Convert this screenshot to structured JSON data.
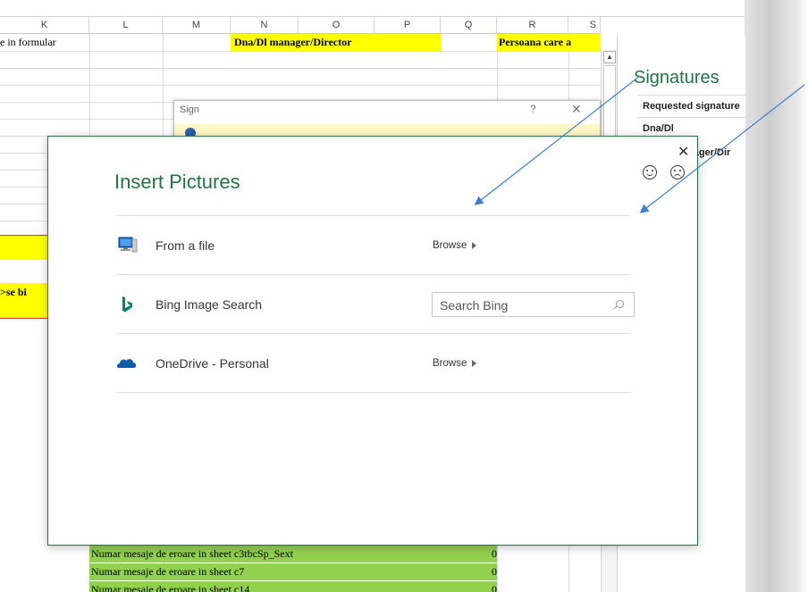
{
  "spreadsheet": {
    "columns": [
      "K",
      "L",
      "M",
      "N",
      "O",
      "P",
      "Q",
      "R",
      "S"
    ],
    "cells": {
      "k_row1": "e in formular",
      "n_row1": "Dna/Dl manager/Director",
      "r_row1": "Persoana care a",
      "k_red": ">se bi"
    },
    "green_rows": [
      {
        "text": "Numar mesaje de eroare  in sheet  c3tbcSp_Sext",
        "value": "0"
      },
      {
        "text": "Numar mesaje de eroare  in sheet  c7",
        "value": "0"
      },
      {
        "text": "Numar mesaje de eroare  in sheet  c14",
        "value": "0"
      }
    ]
  },
  "signatures_pane": {
    "title": "Signatures",
    "requested_label": "Requested signature",
    "signer1": "Dna/Dl",
    "signer2": "nager/Dir"
  },
  "sign_dialog": {
    "title": "Sign",
    "help": "?",
    "close": "✕"
  },
  "insert_pictures": {
    "title": "Insert Pictures",
    "close": "✕",
    "rows": [
      {
        "label": "From a file",
        "action": "Browse"
      },
      {
        "label": "Bing Image Search",
        "placeholder": "Search Bing"
      },
      {
        "label": "OneDrive - Personal",
        "action": "Browse"
      }
    ]
  },
  "colors": {
    "accent": "#217346",
    "yellow": "#ffff00",
    "green": "#92d050",
    "bing": "#008373",
    "onedrive": "#0f5ca8",
    "arrow": "#3b7fd4"
  }
}
